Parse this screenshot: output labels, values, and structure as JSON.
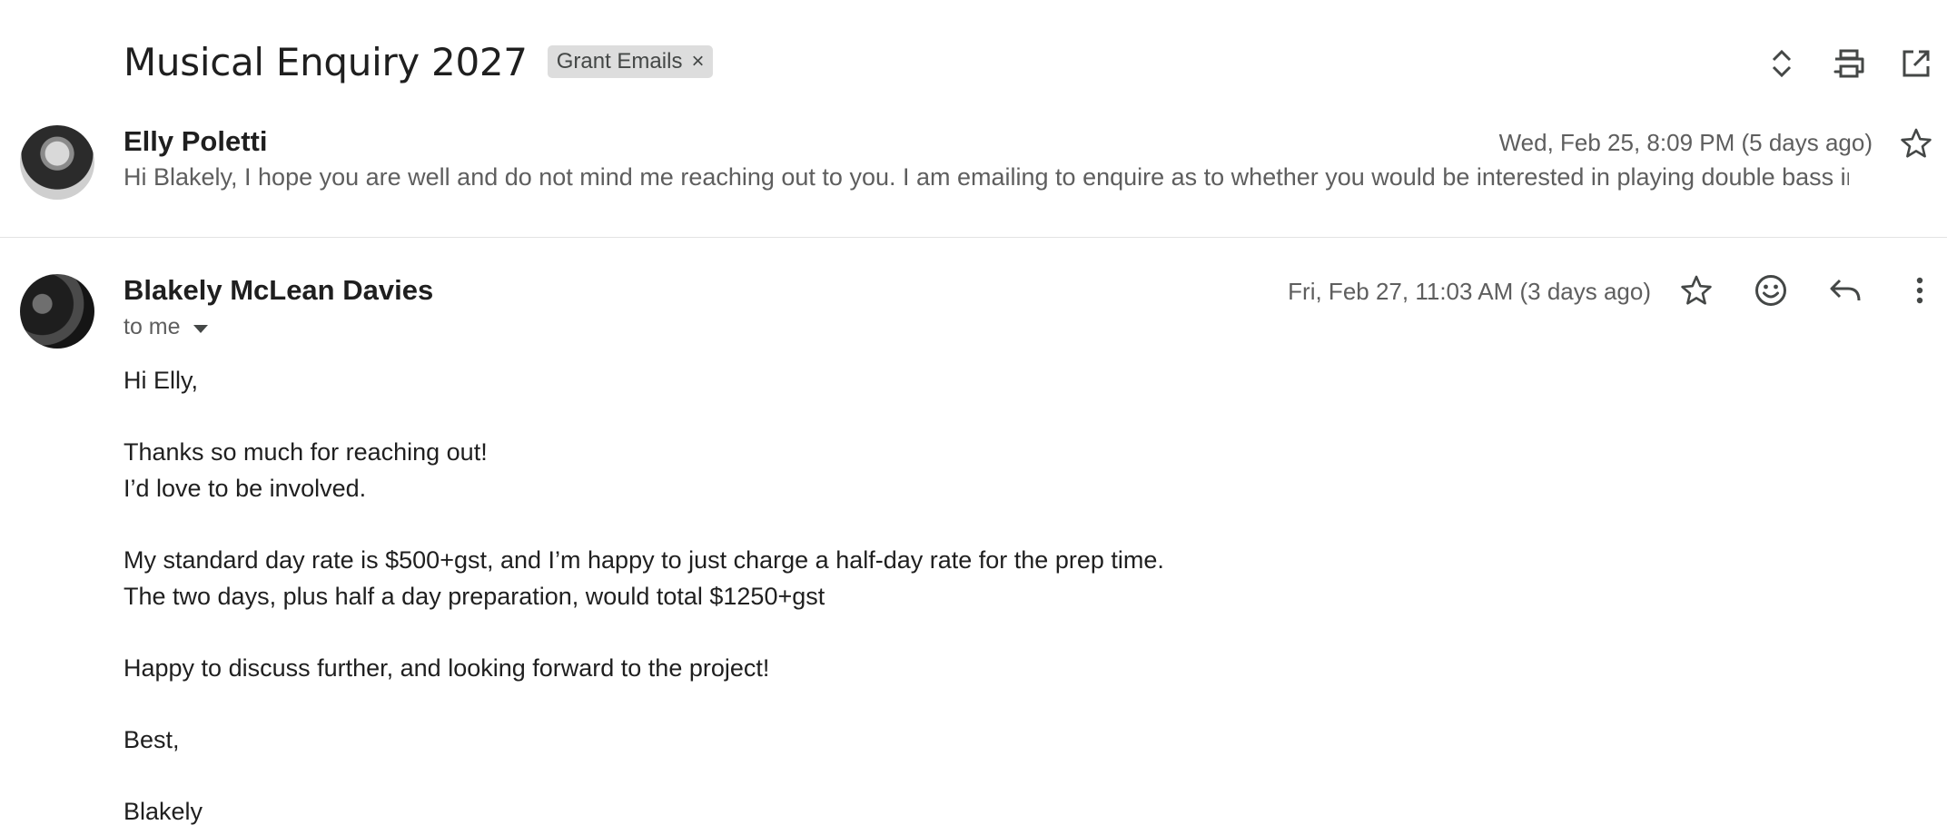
{
  "thread": {
    "subject": "Musical Enquiry 2027",
    "label": "Grant Emails",
    "label_remove": "×"
  },
  "header_icons": [
    "expand-collapse-icon",
    "print-icon",
    "open-in-new-window-icon"
  ],
  "messages": [
    {
      "sender": "Elly Poletti",
      "date": "Wed, Feb 25, 8:09 PM (5 days ago)",
      "snippet": "Hi Blakely, I hope you are well and do not mind me reaching out to you. I am emailing to enquire as to whether you would be interested in playing double bass in"
    },
    {
      "sender": "Blakely McLean Davies",
      "date": "Fri, Feb 27, 11:03 AM (3 days ago)",
      "recipient": "to me",
      "body": {
        "greeting": "Hi Elly,",
        "line1": "Thanks so much for reaching out!",
        "line2": "I’d love to be involved.",
        "line3": "My standard day rate is $500+gst, and I’m happy to just charge a half-day rate for the prep time.",
        "line4": "The two days, plus half a day preparation, would total $1250+gst",
        "line5": "Happy to discuss further, and looking forward to the project!",
        "signoff": "Best,",
        "signature": "Blakely"
      }
    }
  ],
  "message_actions": [
    "star-icon",
    "emoji-reaction-icon",
    "reply-icon",
    "more-options-icon"
  ]
}
